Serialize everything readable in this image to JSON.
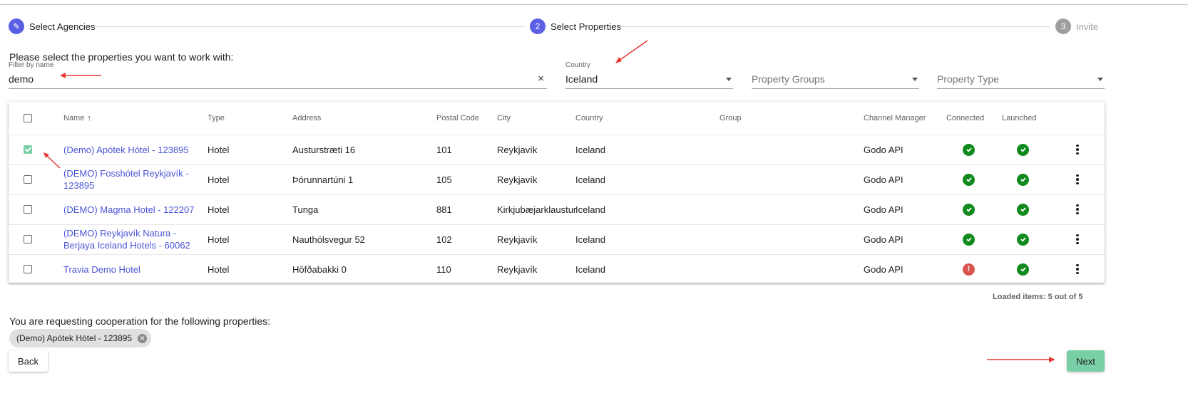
{
  "stepper": {
    "steps": [
      {
        "number": "✎",
        "label": "Select Agencies"
      },
      {
        "number": "2",
        "label": "Select Properties"
      },
      {
        "number": "3",
        "label": "Invite"
      }
    ]
  },
  "instruction": "Please select the properties you want to work with:",
  "filters": {
    "name": {
      "label": "Filter by name",
      "value": "demo",
      "clear": "×"
    },
    "country": {
      "label": "Country",
      "value": "Iceland"
    },
    "property_groups": {
      "placeholder": "Property Groups"
    },
    "property_type": {
      "placeholder": "Property Type"
    }
  },
  "table": {
    "headers": {
      "name": "Name",
      "sort_icon": "↑",
      "type": "Type",
      "address": "Address",
      "postal_code": "Postal Code",
      "city": "City",
      "country": "Country",
      "group": "Group",
      "channel_manager": "Channel Manager",
      "connected": "Connected",
      "launched": "Launched"
    },
    "rows": [
      {
        "name": "(Demo) Apótek Hótel - 123895",
        "type": "Hotel",
        "address": "Austurstræti 16",
        "postal_code": "101",
        "city": "Reykjavík",
        "country": "Iceland",
        "group": "",
        "channel_manager": "Godo API",
        "connected": "ok",
        "launched": "ok",
        "checked": true
      },
      {
        "name": "(DEMO) Fosshótel Reykjavík - 123895",
        "type": "Hotel",
        "address": "Þórunnartúni 1",
        "postal_code": "105",
        "city": "Reykjavík",
        "country": "Iceland",
        "group": "",
        "channel_manager": "Godo API",
        "connected": "ok",
        "launched": "ok",
        "checked": false
      },
      {
        "name": "(DEMO) Magma Hotel - 122207",
        "type": "Hotel",
        "address": "Tunga",
        "postal_code": "881",
        "city": "Kirkjubæjarklaustur",
        "country": "Iceland",
        "group": "",
        "channel_manager": "Godo API",
        "connected": "ok",
        "launched": "ok",
        "checked": false
      },
      {
        "name": "(DEMO) Reykjavík Natura - Berjaya Iceland Hotels - 60062",
        "type": "Hotel",
        "address": "Nauthólsvegur 52",
        "postal_code": "102",
        "city": "Reykjavík",
        "country": "Iceland",
        "group": "",
        "channel_manager": "Godo API",
        "connected": "ok",
        "launched": "ok",
        "checked": false
      },
      {
        "name": "Travia Demo Hotel",
        "type": "Hotel",
        "address": "Höfðabakki 0",
        "postal_code": "110",
        "city": "Reykjavík",
        "country": "Iceland",
        "group": "",
        "channel_manager": "Godo API",
        "connected": "error",
        "launched": "ok",
        "checked": false
      }
    ],
    "error_glyph": "!"
  },
  "loaded_text": "Loaded items: 5 out of 5",
  "requesting_text": "You are requesting cooperation for the following properties:",
  "selected_chips": [
    {
      "label": "(Demo) Apótek Hótel - 123895",
      "remove": "✕"
    }
  ],
  "buttons": {
    "back": "Back",
    "next": "Next"
  },
  "colors": {
    "accent": "#5b5fe4",
    "primary_green": "#7ad0a6",
    "ok": "#118a1d",
    "error": "#d9534f",
    "annotation_arrow": "#e53935"
  }
}
